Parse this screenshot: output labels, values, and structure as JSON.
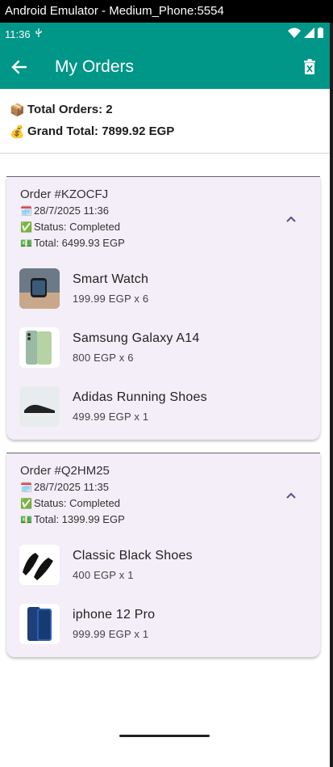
{
  "window_title": "Android Emulator - Medium_Phone:5554",
  "status_bar": {
    "time": "11:36"
  },
  "app_bar": {
    "title": "My Orders"
  },
  "summary": {
    "total_orders_icon": "📦",
    "total_orders": "Total Orders: 2",
    "grand_total_icon": "💰",
    "grand_total": "Grand Total: 7899.92 EGP"
  },
  "orders": [
    {
      "id": "Order #KZOCFJ",
      "date_icon": "🗓️",
      "date": "28/7/2025 11:36",
      "status_icon": "✅",
      "status": "Status: Completed",
      "total_icon": "💵",
      "total": "Total: 6499.93 EGP",
      "items": [
        {
          "name": "Smart Watch",
          "price": "199.99 EGP x 6"
        },
        {
          "name": "Samsung Galaxy A14",
          "price": "800 EGP x 6"
        },
        {
          "name": "Adidas Running Shoes",
          "price": "499.99 EGP x 1"
        }
      ]
    },
    {
      "id": "Order #Q2HM25",
      "date_icon": "🗓️",
      "date": "28/7/2025 11:35",
      "status_icon": "✅",
      "status": "Status: Completed",
      "total_icon": "💵",
      "total": "Total: 1399.99 EGP",
      "items": [
        {
          "name": "Classic Black Shoes",
          "price": "400 EGP x 1"
        },
        {
          "name": "iphone 12 Pro",
          "price": "999.99 EGP x 1"
        }
      ]
    }
  ],
  "colors": {
    "app_bar": "#009688",
    "card_bg": "#f3eef7",
    "chevron": "#5b4e8c"
  },
  "icons": [
    "back-arrow-icon",
    "delete-icon",
    "chevron-up-icon",
    "usb-icon",
    "wifi-icon",
    "signal-icon"
  ]
}
